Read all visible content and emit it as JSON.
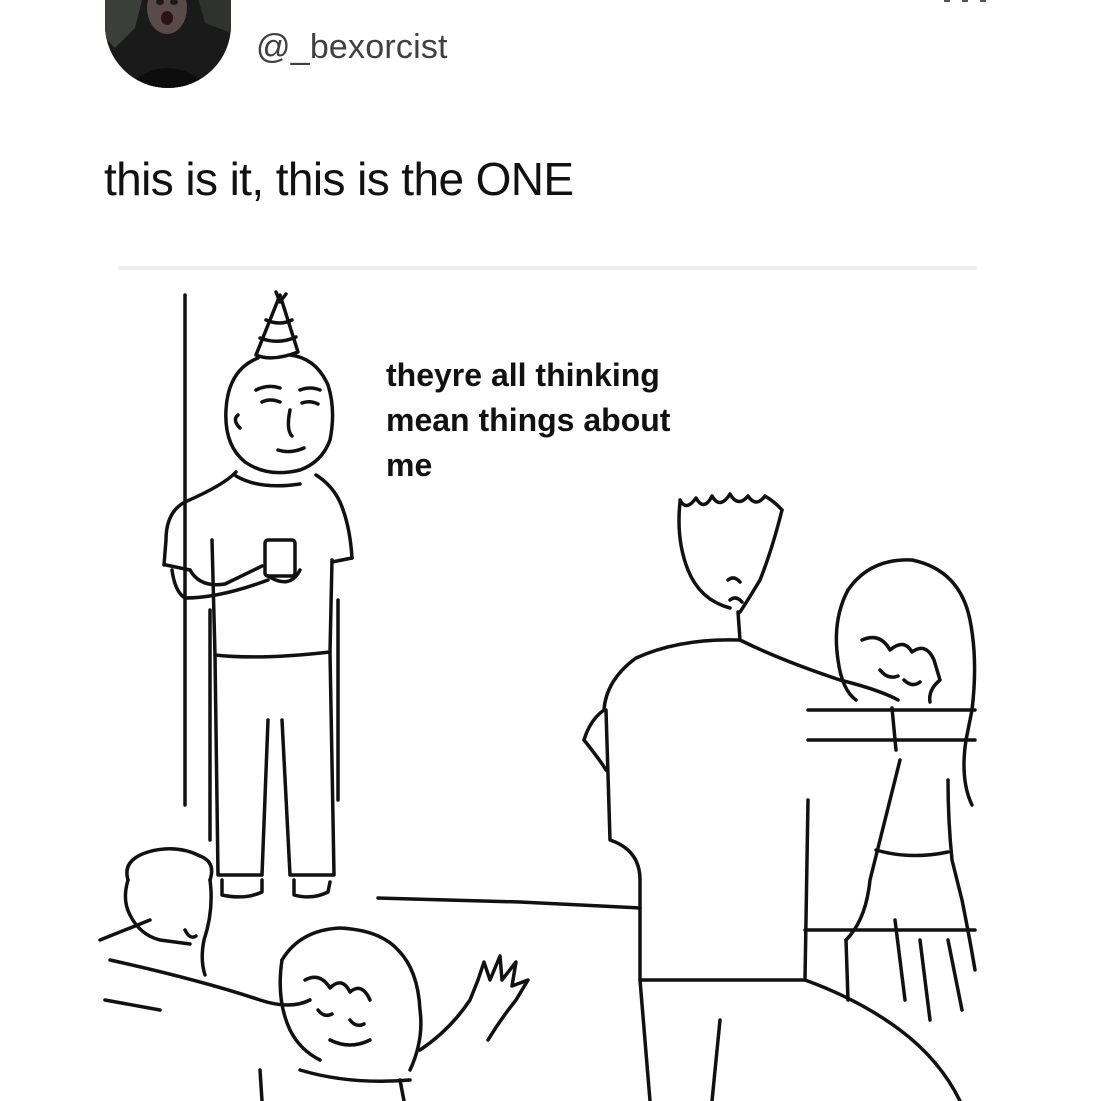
{
  "post": {
    "username": "@_bexorcist",
    "caption": "this is it, this is the ONE"
  },
  "meme": {
    "thought_line1": "theyre all thinking",
    "thought_line2": "mean things about",
    "thought_line3": "me"
  },
  "icons": {
    "more": "more-options-icon",
    "avatar": "profile-avatar"
  }
}
